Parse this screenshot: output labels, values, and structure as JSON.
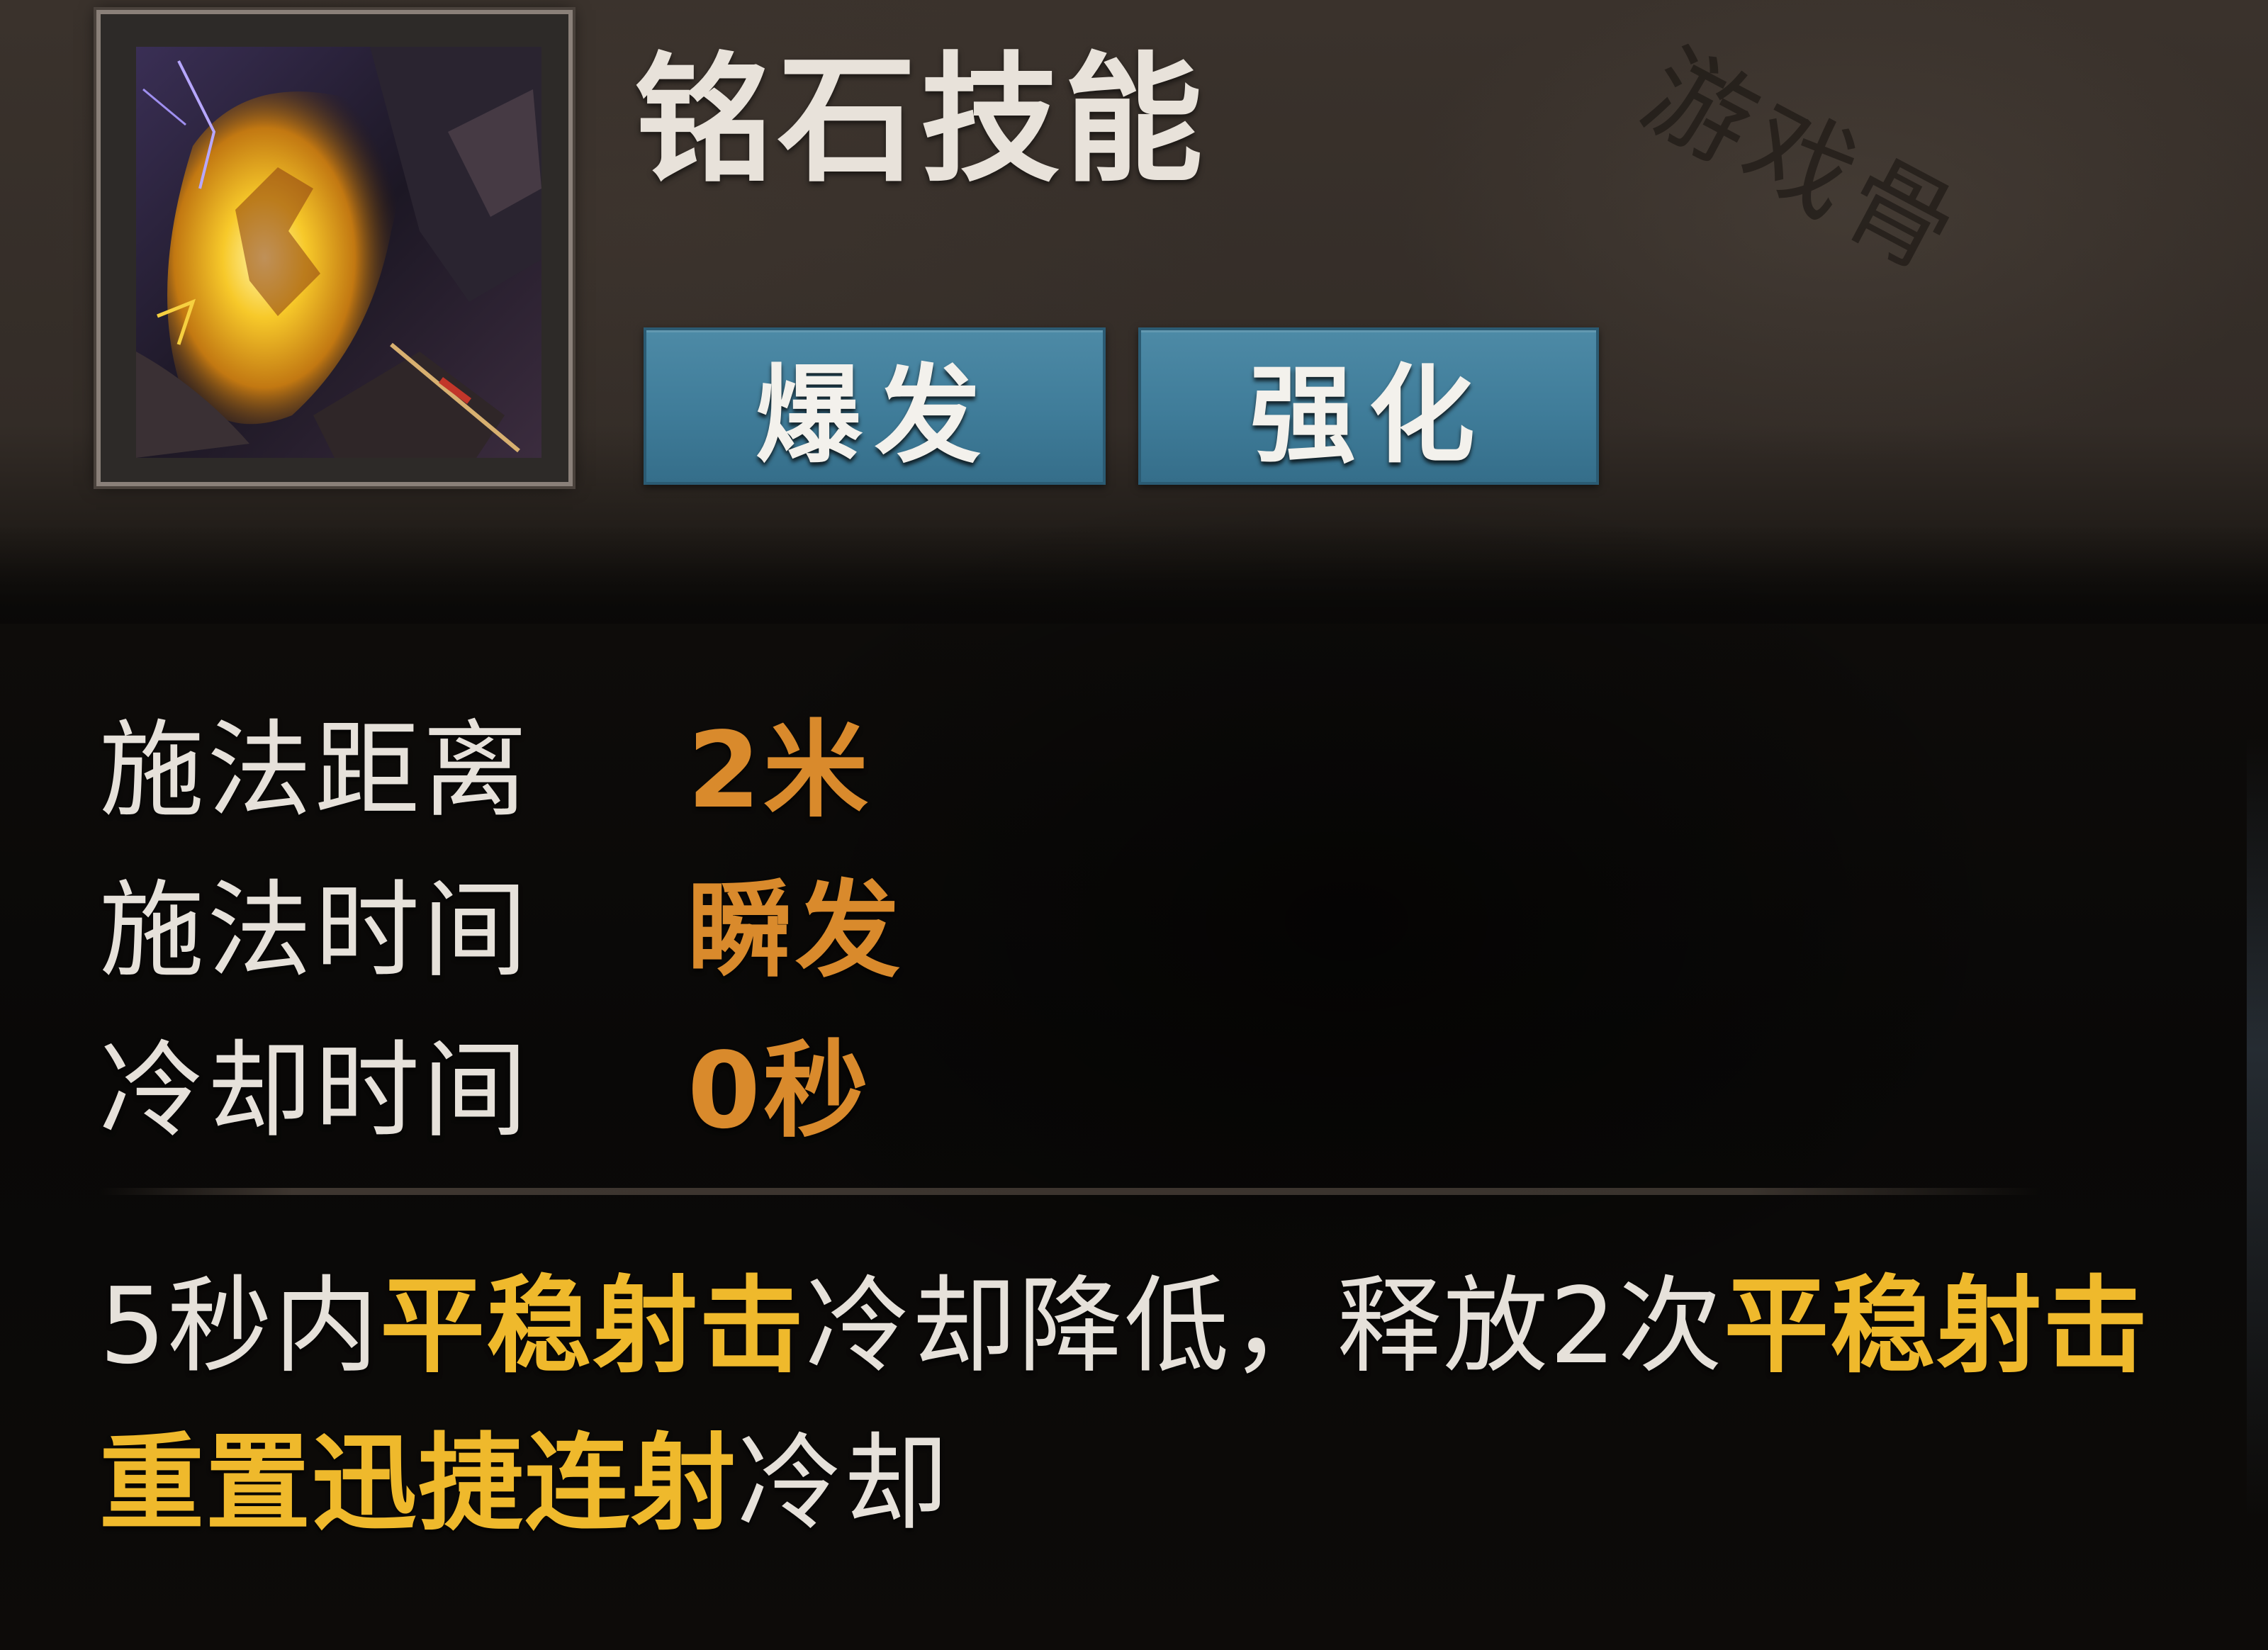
{
  "skill": {
    "title": "铭石技能",
    "icon": "glowing-rune-stone-icon"
  },
  "tabs": [
    {
      "label": "爆发"
    },
    {
      "label": "强化"
    }
  ],
  "stats": [
    {
      "label": "施法距离",
      "value": "2米"
    },
    {
      "label": "施法时间",
      "value": "瞬发"
    },
    {
      "label": "冷却时间",
      "value": "0秒"
    }
  ],
  "description": {
    "segments": [
      "5秒内",
      "平稳射击",
      "冷却降低，释放2次",
      "平稳射击",
      "重置",
      "迅捷连射",
      "冷却"
    ]
  },
  "colors": {
    "tab_background": "#3f7c99",
    "stat_value": "#d98a2c",
    "highlight_text": "#efb92c",
    "body_text": "#e6e1da"
  }
}
